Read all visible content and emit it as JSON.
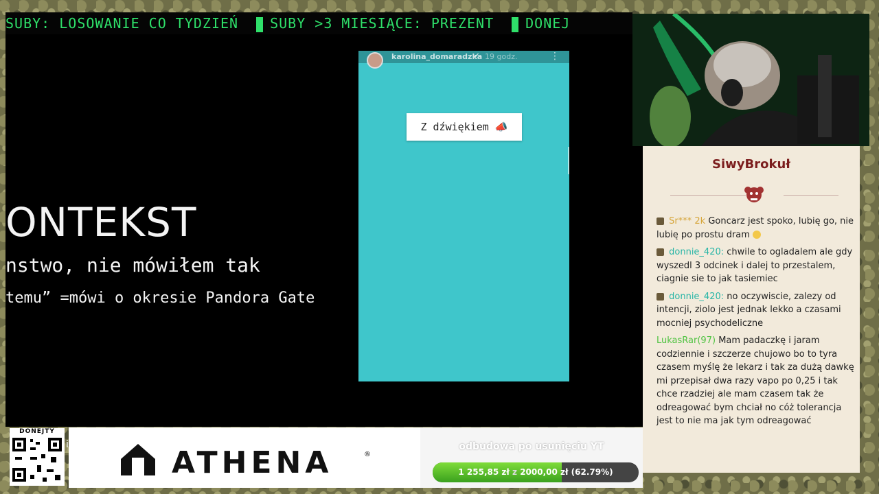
{
  "ticker": {
    "part1": "SUBY: LOSOWANIE CO TYDZIEŃ",
    "part2": "SUBY >3 MIESIĄCE: PREZENT",
    "part3": "DONEJ"
  },
  "slide": {
    "heading": "ONTEKST",
    "line1": "nstwo, nie mówiłem tak",
    "line2": "temu” =mówi o okresie Pandora Gate"
  },
  "story": {
    "username": "karolina_domaradzka",
    "time": "19 godz.",
    "sticker": "Z dźwiękiem 📣",
    "bg_color": "#3fc6cb"
  },
  "chat": {
    "title": "SiwyBrokuł",
    "messages": [
      {
        "user": "Sr*** 2k",
        "user_color": "gold",
        "text": "Goncarz jest spoko, lubię go, nie lubię po prostu dram"
      },
      {
        "user": "donnie_420:",
        "user_color": "teal",
        "text": "chwile to ogladalem ale gdy wyszedl 3 odcinek i dalej to przestalem, ciagnie sie to jak tasiemiec"
      },
      {
        "user": "donnie_420:",
        "user_color": "teal",
        "text": "no oczywiscie, zalezy od intencji, ziolo jest jednak lekko a czasami mocniej psychodeliczne"
      },
      {
        "user": "LukasRar(97)",
        "user_color": "green",
        "text": "Mam padaczkę i jaram codziennie i szczerze chujowo bo to tyra czasem myślę że lekarz i tak za dużą dawkę mi przepisał dwa razy vapo po 0,25 i tak chce rzadziej ale mam czasem tak że odreagować bym chciał no cóż tolerancja jest to nie ma jak tym odreagować"
      }
    ]
  },
  "ad": {
    "brand": "ATHENA",
    "reg": "®"
  },
  "qr": {
    "label": "DONEJTY"
  },
  "goal": {
    "title": "odbudowa po usunięciu YT",
    "current": "1 255,85 zł",
    "sep": "z",
    "target": "2000,00 zł",
    "percent_label": "(62.79%)",
    "progress": 0.6279
  },
  "colors": {
    "ticker": "#2fe06a",
    "chat_title": "#7b1d1d",
    "goal_fill": "#5cc12a"
  }
}
